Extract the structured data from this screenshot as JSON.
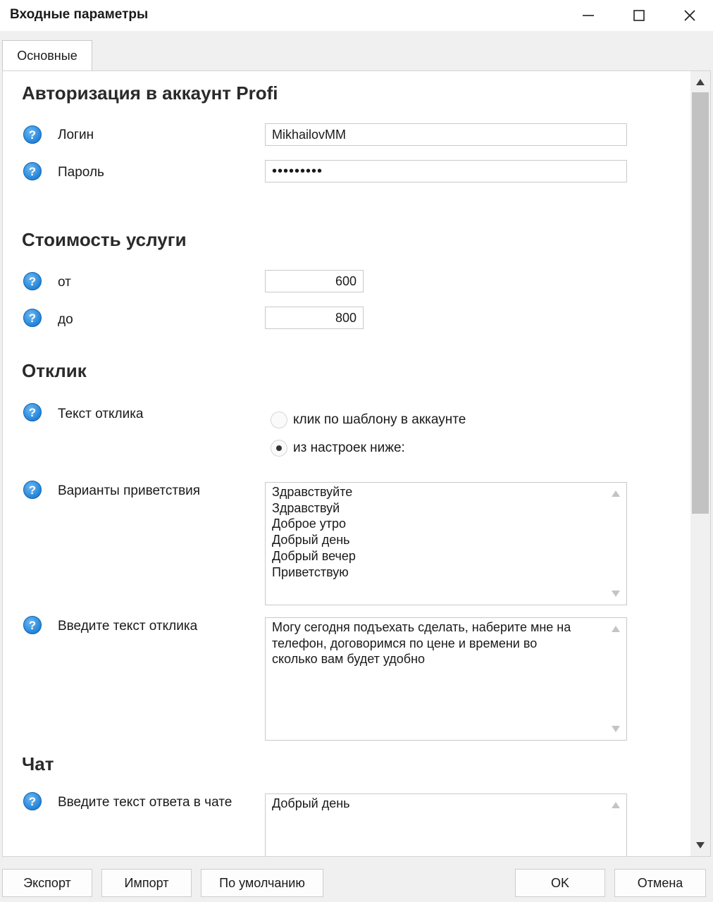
{
  "window": {
    "title": "Входные параметры"
  },
  "tabs": [
    {
      "label": "Основные",
      "active": true
    }
  ],
  "sections": {
    "auth": {
      "title": "Авторизация в аккаунт Profi",
      "login_label": "Логин",
      "login_value": "MikhailovMM",
      "password_label": "Пароль",
      "password_value": "•••••••••"
    },
    "price": {
      "title": "Стоимость услуги",
      "from_label": "от",
      "from_value": "600",
      "to_label": "до",
      "to_value": "800"
    },
    "response": {
      "title": "Отклик",
      "text_label": "Текст отклика",
      "radio_options": [
        {
          "label": "клик по шаблону в аккаунте",
          "selected": false
        },
        {
          "label": "из настроек ниже:",
          "selected": true
        }
      ],
      "greetings_label": "Варианты приветствия",
      "greetings_value": "Здравствуйте\nЗдравствуй\nДоброе утро\nДобрый день\nДобрый вечер\nПриветствую",
      "response_text_label": "Введите текст отклика",
      "response_text_value": "Могу сегодня подъехать сделать, наберите мне на\nтелефон, договоримся по цене и времени во\nсколько вам будет удобно"
    },
    "chat": {
      "title": "Чат",
      "reply_label": "Введите текст ответа в чате",
      "reply_value": "Добрый день"
    }
  },
  "buttons": {
    "export": "Экспорт",
    "import": "Импорт",
    "default": "По умолчанию",
    "ok": "OK",
    "cancel": "Отмена"
  },
  "icons": {
    "help": "help-question-icon",
    "minimize": "minimize-icon",
    "maximize": "maximize-icon",
    "close": "close-icon"
  },
  "colors": {
    "help_icon": "#1e7fd6",
    "window_bg": "#f0f0f0",
    "content_bg": "#ffffff"
  }
}
